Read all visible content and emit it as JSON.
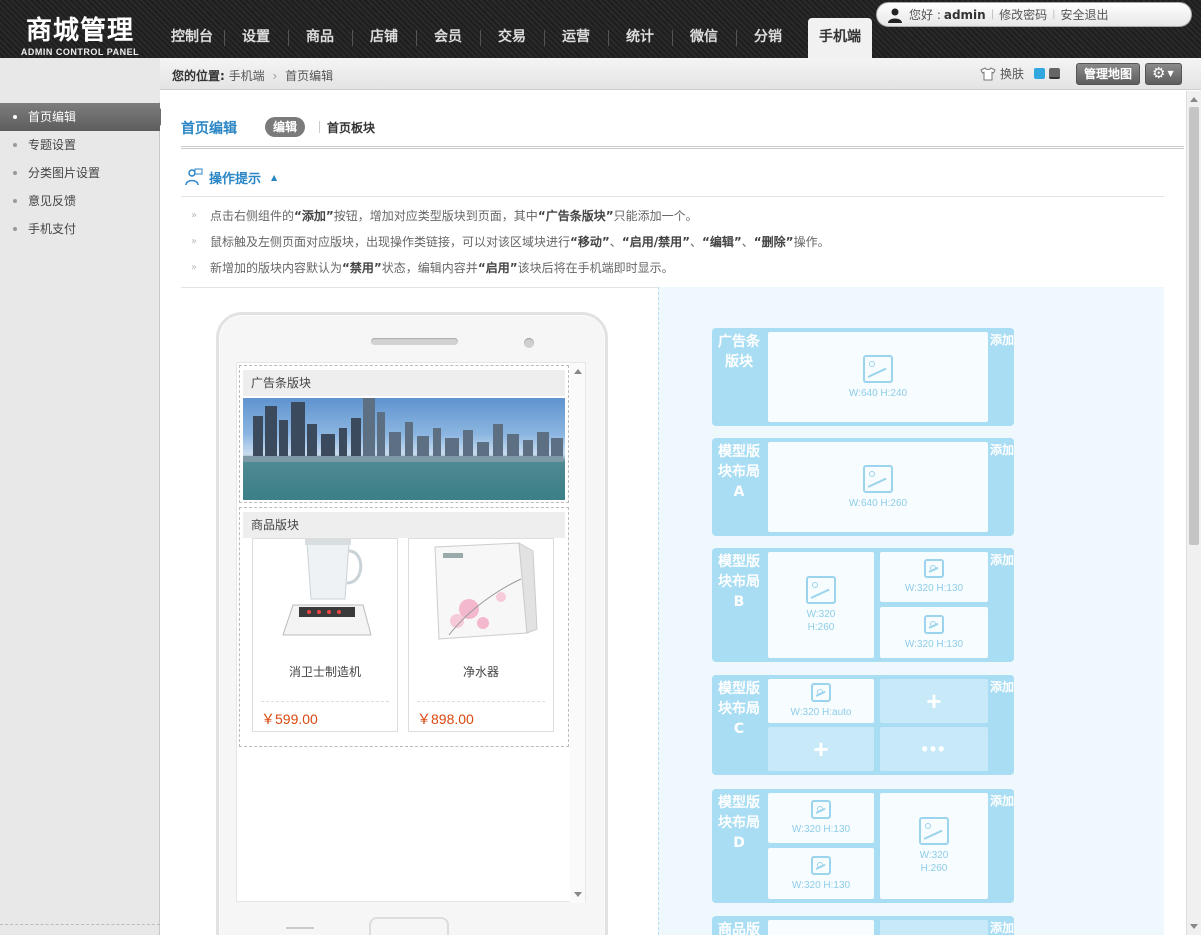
{
  "logo": {
    "title": "商城管理",
    "subtitle": "ADMIN CONTROL PANEL"
  },
  "nav": [
    {
      "label": "控制台"
    },
    {
      "label": "设置"
    },
    {
      "label": "商品"
    },
    {
      "label": "店铺"
    },
    {
      "label": "会员"
    },
    {
      "label": "交易"
    },
    {
      "label": "运营"
    },
    {
      "label": "统计"
    },
    {
      "label": "微信"
    },
    {
      "label": "分销"
    },
    {
      "label": "手机端",
      "active": true
    }
  ],
  "userbar": {
    "greeting": "您好 :",
    "username": "admin",
    "change_password": "修改密码",
    "logout": "安全退出"
  },
  "breadcrumb": {
    "prefix": "您的位置:",
    "level1": "手机端",
    "level2": "首页编辑"
  },
  "toolbar": {
    "skin_label": "换肤",
    "skin_colors": [
      "#31a7e0",
      "#666666"
    ],
    "map_button": "管理地图"
  },
  "sidebar": {
    "items": [
      {
        "label": "首页编辑",
        "active": true
      },
      {
        "label": "专题设置"
      },
      {
        "label": "分类图片设置"
      },
      {
        "label": "意见反馈"
      },
      {
        "label": "手机支付"
      }
    ]
  },
  "tabs": {
    "title": "首页编辑",
    "active": "编辑",
    "other": "首页板块"
  },
  "tips": {
    "title": "操作提示",
    "items": [
      {
        "pre": "点击右侧组件的",
        "b1": "“添加”",
        "mid": "按钮，增加对应类型版块到页面，其中",
        "b2": "“广告条版块”",
        "post": "只能添加一个。"
      },
      {
        "pre": "鼠标触及左侧页面对应版块，出现操作类链接，可以对该区域块进行",
        "b1": "“移动”",
        "s1": "、",
        "b2": "“启用/禁用”",
        "s2": "、",
        "b3": "“编辑”",
        "s3": "、",
        "b4": "“删除”",
        "post": "操作。"
      },
      {
        "pre": "新增加的版块内容默认为",
        "b1": "“禁用”",
        "mid": "状态，编辑内容并",
        "b2": "“启用”",
        "post": "该块后将在手机端即时显示。"
      }
    ]
  },
  "phone": {
    "banner_block_title": "广告条版块",
    "goods_block_title": "商品版块",
    "goods": [
      {
        "name": "消卫士制造机",
        "price": "￥599.00"
      },
      {
        "name": "净水器",
        "price": "￥898.00"
      }
    ]
  },
  "modules": {
    "add_label": "添加",
    "banner": {
      "label": "广告条版块",
      "size": "W:640  H:240"
    },
    "a": {
      "label": "模型版块布局A",
      "size": "W:640  H:260"
    },
    "b": {
      "label": "模型版块布局B",
      "big_w": "W:320",
      "big_h": "H:260",
      "small1": "W:320  H:130",
      "small2": "W:320  H:130"
    },
    "c": {
      "label": "模型版块布局C",
      "cell1": "W:320  H:auto"
    },
    "d": {
      "label": "模型版块布局D",
      "small1": "W:320  H:130",
      "small2": "W:320  H:130",
      "big_w": "W:320",
      "big_h": "H:260"
    },
    "goods": {
      "label": "商品版"
    }
  }
}
